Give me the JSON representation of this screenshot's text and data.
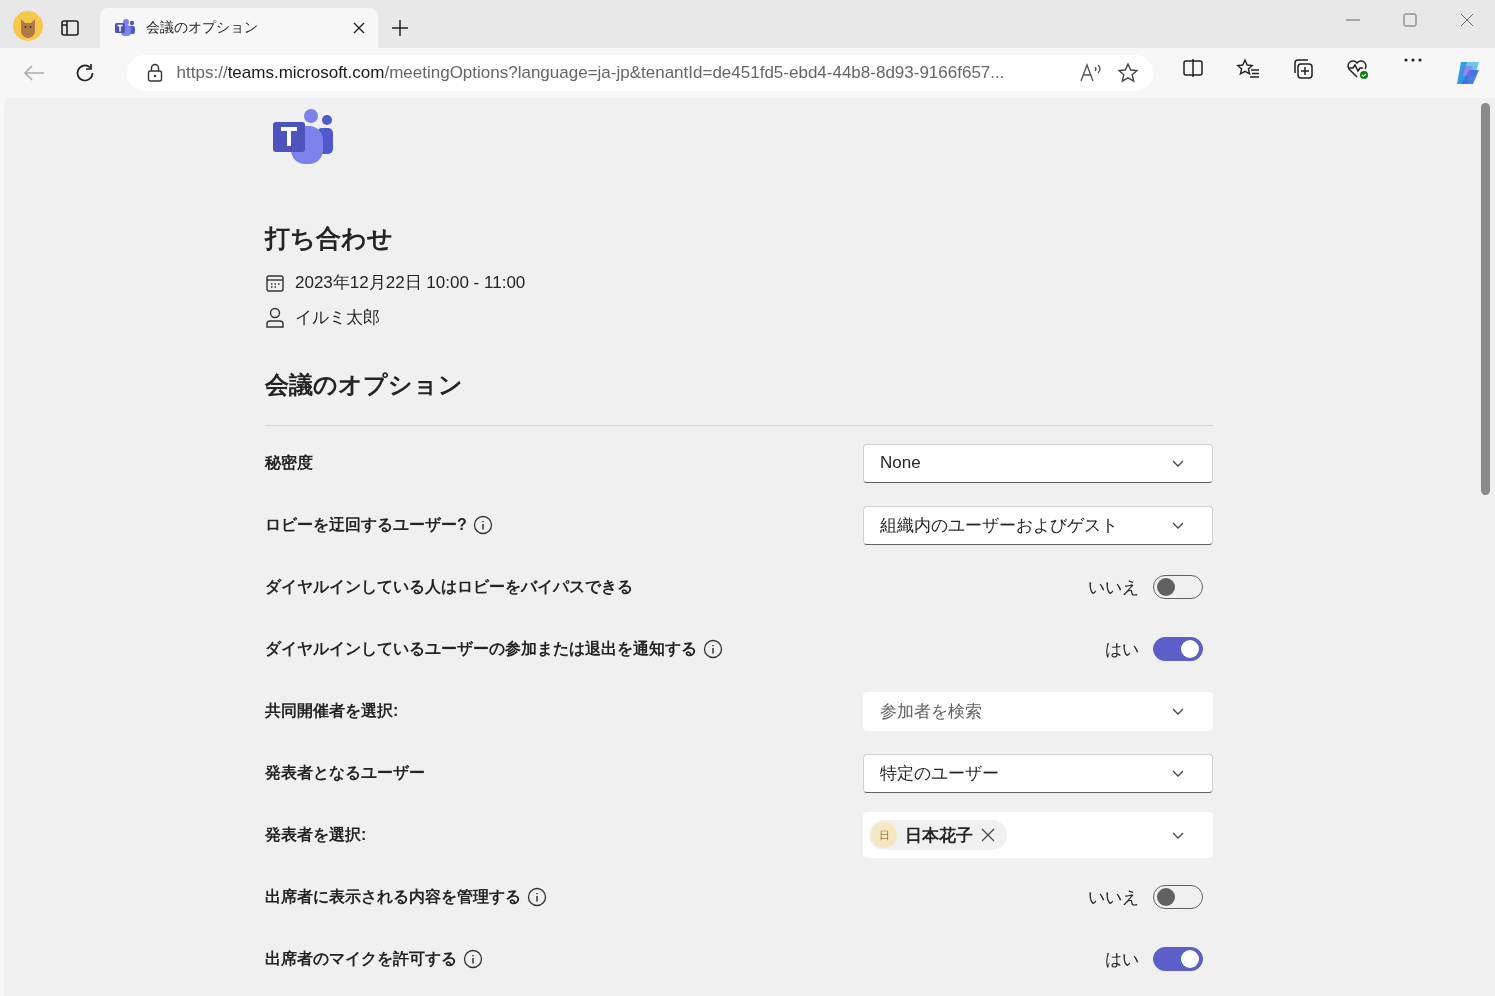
{
  "browser": {
    "tab": {
      "title": "会議のオプション",
      "selected": true
    },
    "url": {
      "scheme": "https://",
      "host": "teams.microsoft.com",
      "rest": "/meetingOptions?language=ja-jp&tenantId=de451fd5-ebd4-44b8-8d93-9166f657..."
    }
  },
  "meeting": {
    "title": "打ち合わせ",
    "date": "2023年12月22日 10:00 - 11:00",
    "organizer": "イルミ太郎"
  },
  "section_title": "会議のオプション",
  "options": [
    {
      "kind": "dropdown",
      "label": "秘密度",
      "info": false,
      "value": "None"
    },
    {
      "kind": "dropdown",
      "label": "ロビーを迂回するユーザー?",
      "info": true,
      "value": "組織内のユーザーおよびゲスト"
    },
    {
      "kind": "toggle",
      "label": "ダイヤルインしている人はロビーをバイパスできる",
      "info": false,
      "on": false,
      "state_label": "いいえ"
    },
    {
      "kind": "toggle",
      "label": "ダイヤルインしているユーザーの参加または退出を通知する",
      "info": true,
      "on": true,
      "state_label": "はい"
    },
    {
      "kind": "search",
      "label": "共同開催者を選択:",
      "info": false,
      "placeholder": "参加者を検索"
    },
    {
      "kind": "dropdown",
      "label": "発表者となるユーザー",
      "info": false,
      "value": "特定のユーザー"
    },
    {
      "kind": "people",
      "label": "発表者を選択:",
      "info": false,
      "people": [
        {
          "initial": "日",
          "name": "日本花子"
        }
      ]
    },
    {
      "kind": "toggle",
      "label": "出席者に表示される内容を管理する",
      "info": true,
      "on": false,
      "state_label": "いいえ"
    },
    {
      "kind": "toggle",
      "label": "出席者のマイクを許可する",
      "info": true,
      "on": true,
      "state_label": "はい"
    }
  ]
}
